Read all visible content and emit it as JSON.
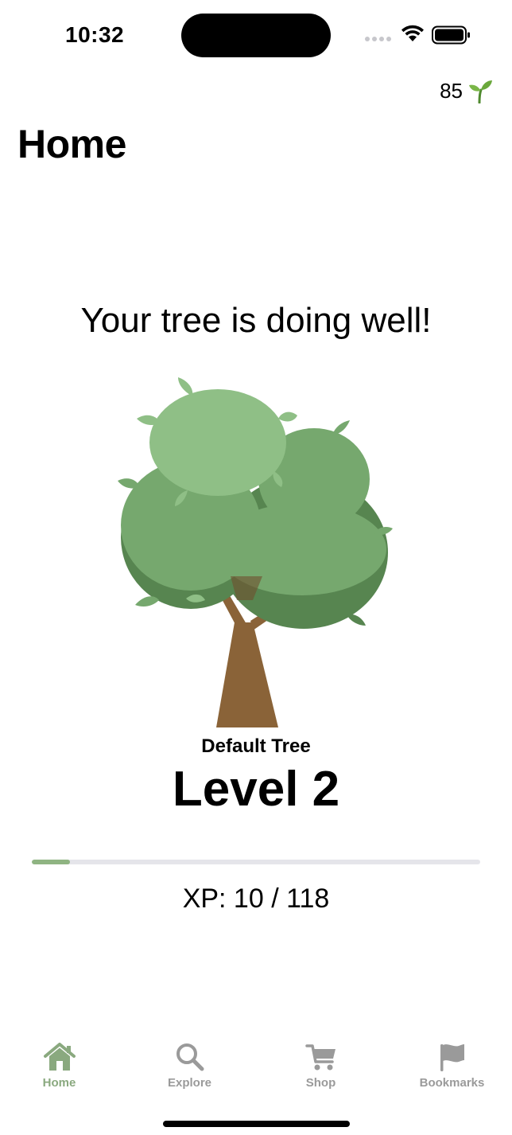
{
  "status_bar": {
    "time": "10:32"
  },
  "header": {
    "points": "85",
    "points_icon": "sprout-icon",
    "title": "Home"
  },
  "main": {
    "status_message": "Your tree is doing well!",
    "tree_name": "Default Tree",
    "level": "Level 2",
    "xp_text": "XP: 10 / 118",
    "xp_current": 10,
    "xp_max": 118
  },
  "tabs": [
    {
      "label": "Home",
      "icon": "house-icon",
      "active": true
    },
    {
      "label": "Explore",
      "icon": "search-icon",
      "active": false
    },
    {
      "label": "Shop",
      "icon": "cart-icon",
      "active": false
    },
    {
      "label": "Bookmarks",
      "icon": "flag-icon",
      "active": false
    }
  ],
  "colors": {
    "accent": "#8aa97f",
    "inactive": "#9a9a9a",
    "xp_fill": "#8fb482",
    "xp_track": "#e5e5ea",
    "foliage_light": "#8fbf86",
    "foliage_mid": "#76a86e",
    "foliage_dark": "#578550",
    "trunk": "#8a6338"
  }
}
